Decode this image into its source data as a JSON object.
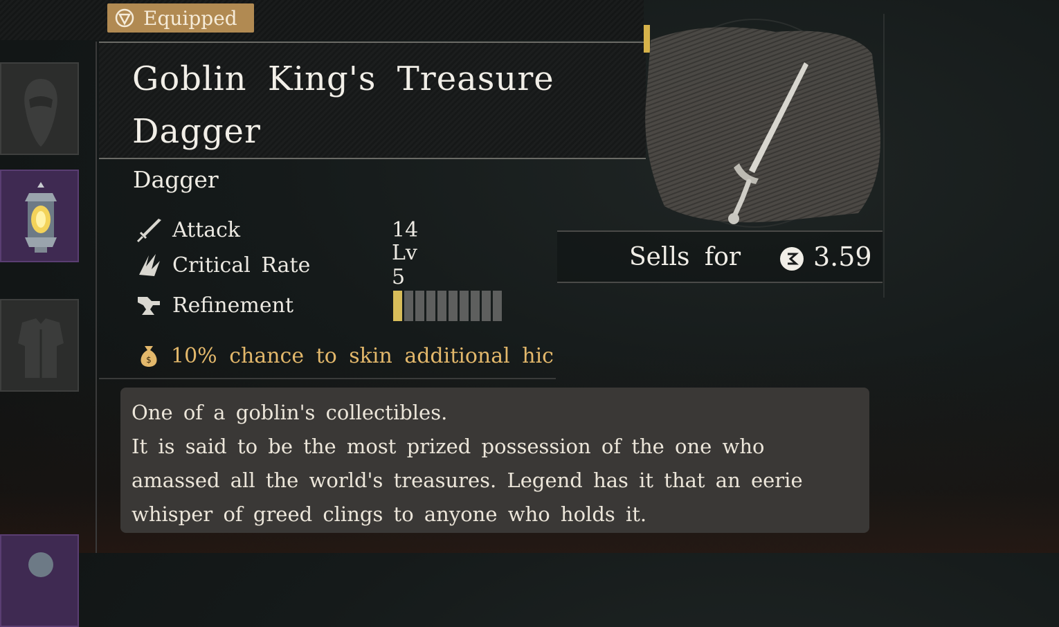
{
  "badge": {
    "label": "Equipped",
    "icon": "shield-icon",
    "color": "#b18a52"
  },
  "item": {
    "title_line1": "Goblin King's Treasure",
    "title_line2": "Dagger",
    "type": "Dagger"
  },
  "stats": [
    {
      "icon": "sword-icon",
      "label": "Attack",
      "value": "14"
    },
    {
      "icon": "critical-slash-icon",
      "label": "Critical Rate",
      "value": "Lv 5"
    },
    {
      "icon": "anvil-icon",
      "label": "Refinement",
      "value_fraction": 0.1,
      "segments_total": 10,
      "segments_filled": 1
    }
  ],
  "effect": {
    "icon": "money-bag-icon",
    "text": "10% chance to skin additional hic",
    "color": "#e3b86b"
  },
  "description": {
    "lines": [
      "One of a goblin's collectibles.",
      "It is said to be the most prized possession of the one who",
      "amassed all the world's treasures. Legend has it that an eerie",
      "whisper of greed clings to anyone who holds it."
    ]
  },
  "sell": {
    "label": "Sells for",
    "icon": "coin-icon",
    "value": "3.59"
  },
  "slots": [
    {
      "icon": "hooded-figure-icon"
    },
    {
      "icon": "lantern-icon"
    },
    {
      "icon": "armor-icon"
    },
    {
      "icon": "item-icon"
    }
  ],
  "colors": {
    "accent_gold": "#d6b24a",
    "rare_purple": "#3f2a52"
  }
}
